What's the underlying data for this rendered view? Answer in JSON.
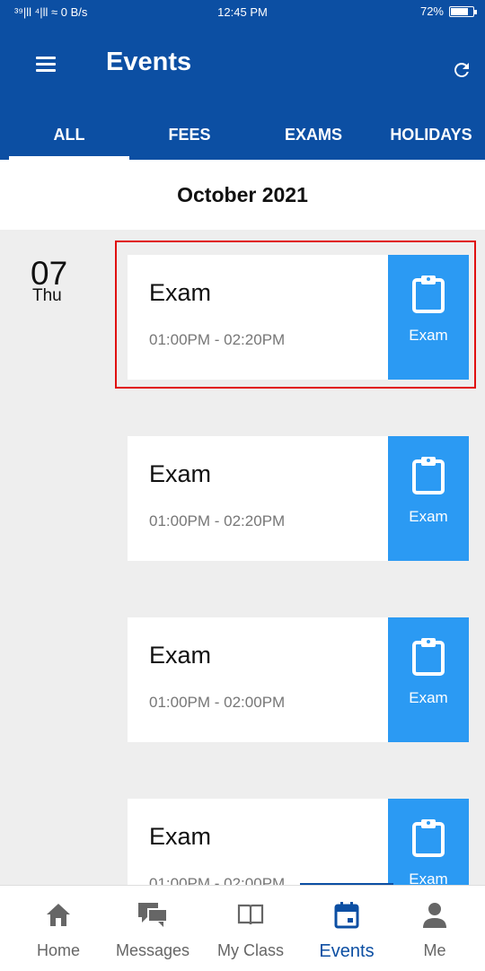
{
  "status_bar": {
    "left": "³⁹|ll ⁴|ll ≈  0 B/s",
    "time": "12:45 PM",
    "battery": "72%"
  },
  "app_bar": {
    "title": "Events"
  },
  "tabs": [
    {
      "label": "ALL",
      "active": true
    },
    {
      "label": "FEES",
      "active": false
    },
    {
      "label": "EXAMS",
      "active": false
    },
    {
      "label": "HOLIDAYS",
      "active": false
    }
  ],
  "month_label": "October 2021",
  "date": {
    "day_number": "07",
    "weekday": "Thu"
  },
  "events": [
    {
      "title": "Exam",
      "time": "01:00PM - 02:20PM",
      "tag": "Exam"
    },
    {
      "title": "Exam",
      "time": "01:00PM - 02:20PM",
      "tag": "Exam"
    },
    {
      "title": "Exam",
      "time": "01:00PM - 02:00PM",
      "tag": "Exam"
    },
    {
      "title": "Exam",
      "time": "01:00PM - 02:00PM",
      "tag": "Exam"
    }
  ],
  "bottom_nav": [
    {
      "label": "Home",
      "icon": "home-icon"
    },
    {
      "label": "Messages",
      "icon": "messages-icon"
    },
    {
      "label": "My Class",
      "icon": "book-icon"
    },
    {
      "label": "Events",
      "icon": "calendar-icon",
      "active": true
    },
    {
      "label": "Me",
      "icon": "person-icon"
    }
  ],
  "colors": {
    "primary": "#0c4fa3",
    "accent": "#2b9af3",
    "highlight": "#e01010",
    "list_bg": "#eeeeee"
  }
}
